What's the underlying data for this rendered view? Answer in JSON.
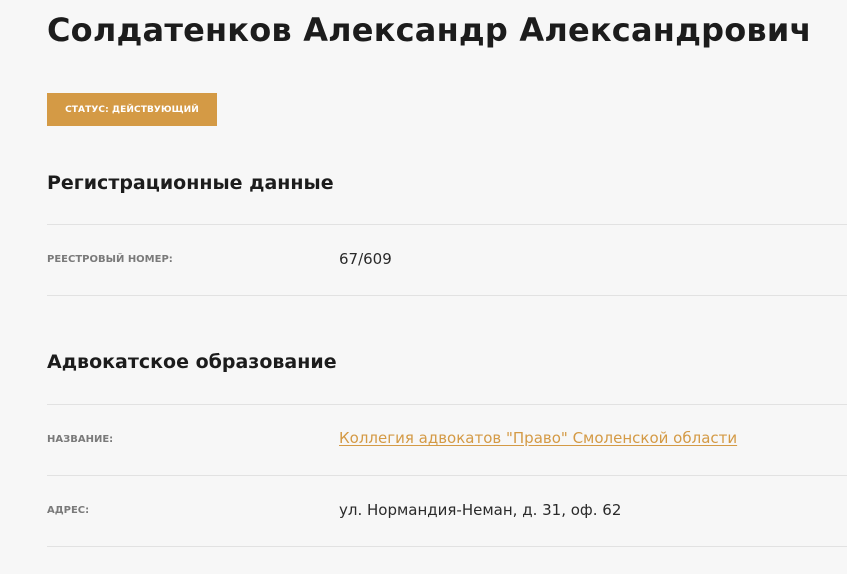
{
  "profile": {
    "name": "Солдатенков Александр Александрович",
    "status_label": "СТАТУС: ДЕЙСТВУЮЩИЙ"
  },
  "registration": {
    "heading": "Регистрационные данные",
    "registry_number_label": "РЕЕСТРОВЫЙ НОМЕР:",
    "registry_number_value": "67/609"
  },
  "organization": {
    "heading": "Адвокатское образование",
    "name_label": "НАЗВАНИЕ:",
    "name_value": "Коллегия адвокатов \"Право\" Смоленской области",
    "address_label": "АДРЕС:",
    "address_value": "ул. Нормандия-Неман, д. 31, оф. 62"
  },
  "colors": {
    "accent": "#d49a45",
    "background": "#f7f7f7",
    "divider": "#e2e2e2",
    "label": "#7a7a7a",
    "text": "#1c1c1c"
  }
}
